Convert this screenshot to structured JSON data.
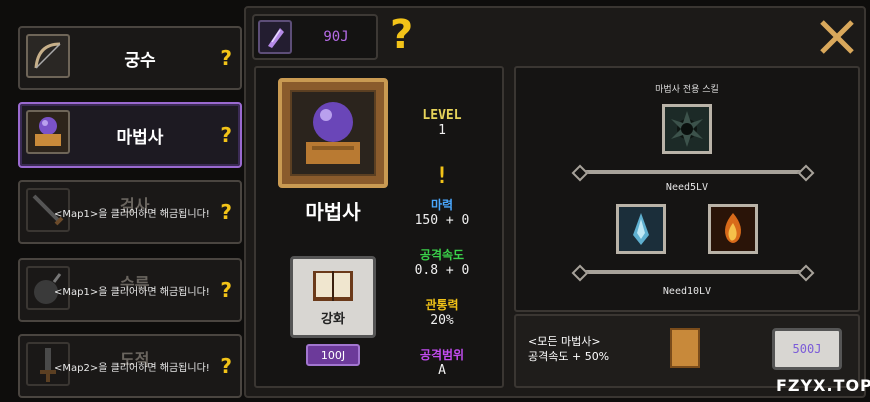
{
  "classes": [
    {
      "name": "궁수",
      "locked": false,
      "selected": false
    },
    {
      "name": "마법사",
      "locked": false,
      "selected": true
    },
    {
      "name": "검사",
      "locked": true,
      "lock_text": "<Map1>을 클리어하면 해금됩니다!"
    },
    {
      "name": "수류",
      "locked": true,
      "lock_text": "<Map1>을 클리어하면 해금됩니다!"
    },
    {
      "name": "도적",
      "locked": true,
      "lock_text": "<Map2>을 클리어하면 해금됩니다!"
    }
  ],
  "help_mark": "?",
  "gold": {
    "value": "90J"
  },
  "detail": {
    "class_name": "마법사",
    "level_label": "LEVEL",
    "level_value": "1",
    "alert": "!",
    "stats": [
      {
        "label": "마력",
        "value": "150 + 0",
        "color": "#4aa8ff"
      },
      {
        "label": "공격속도",
        "value": "0.8 + 0",
        "color": "#3ad14a"
      },
      {
        "label": "관통력",
        "value": "20%",
        "color": "#f2c318"
      },
      {
        "label": "공격범위",
        "value": "A",
        "color": "#c24cf0"
      }
    ],
    "upgrade_label": "강화",
    "upgrade_cost": "100J"
  },
  "skills": {
    "title": "마법사 전용 스킬",
    "need1": "Need5LV",
    "need2": "Need10LV"
  },
  "bonus": {
    "line1": "<모든 마법사>",
    "line2": "공격속도 + 50%",
    "cost": "500J"
  },
  "watermark": "FZYX.TOP",
  "colors": {
    "accent_purple": "#9a6ad0",
    "gold_yellow": "#f2c318",
    "level_yellow": "#e6d35a"
  }
}
